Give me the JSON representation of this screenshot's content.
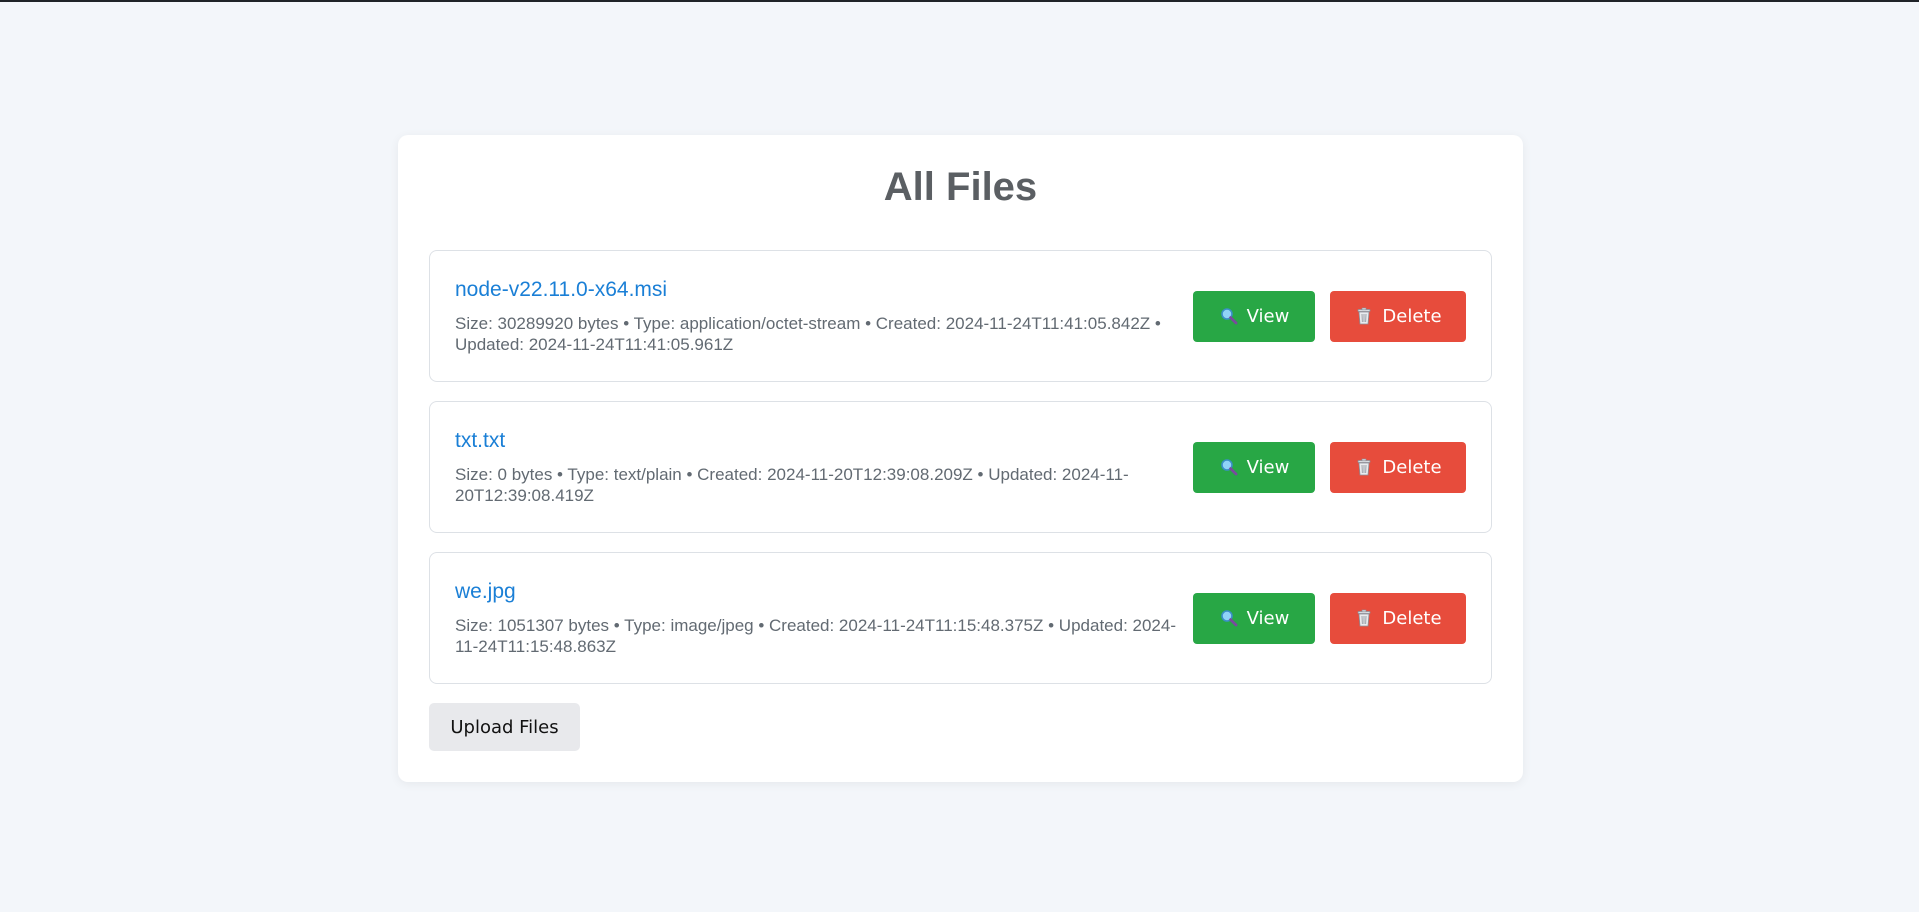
{
  "page": {
    "title": "All Files"
  },
  "files": [
    {
      "name": "node-v22.11.0-x64.msi",
      "meta": "Size: 30289920 bytes • Type: application/octet-stream • Created: 2024-11-24T11:41:05.842Z • Updated: 2024-11-24T11:41:05.961Z",
      "view_label": "View",
      "delete_label": "Delete"
    },
    {
      "name": "txt.txt",
      "meta": "Size: 0 bytes • Type: text/plain • Created: 2024-11-20T12:39:08.209Z • Updated: 2024-11-20T12:39:08.419Z",
      "view_label": "View",
      "delete_label": "Delete"
    },
    {
      "name": "we.jpg",
      "meta": "Size: 1051307 bytes • Type: image/jpeg • Created: 2024-11-24T11:15:48.375Z • Updated: 2024-11-24T11:15:48.863Z",
      "view_label": "View",
      "delete_label": "Delete"
    }
  ],
  "actions": {
    "upload_label": "Upload Files"
  },
  "icons": {
    "view": "magnifier-icon",
    "delete": "trash-can-icon"
  },
  "colors": {
    "background": "#f3f6fa",
    "link": "#1a7fd6",
    "view_button": "#28a745",
    "delete_button": "#e74c3c",
    "upload_button": "#e8e9ec",
    "title": "#5b5f63"
  }
}
